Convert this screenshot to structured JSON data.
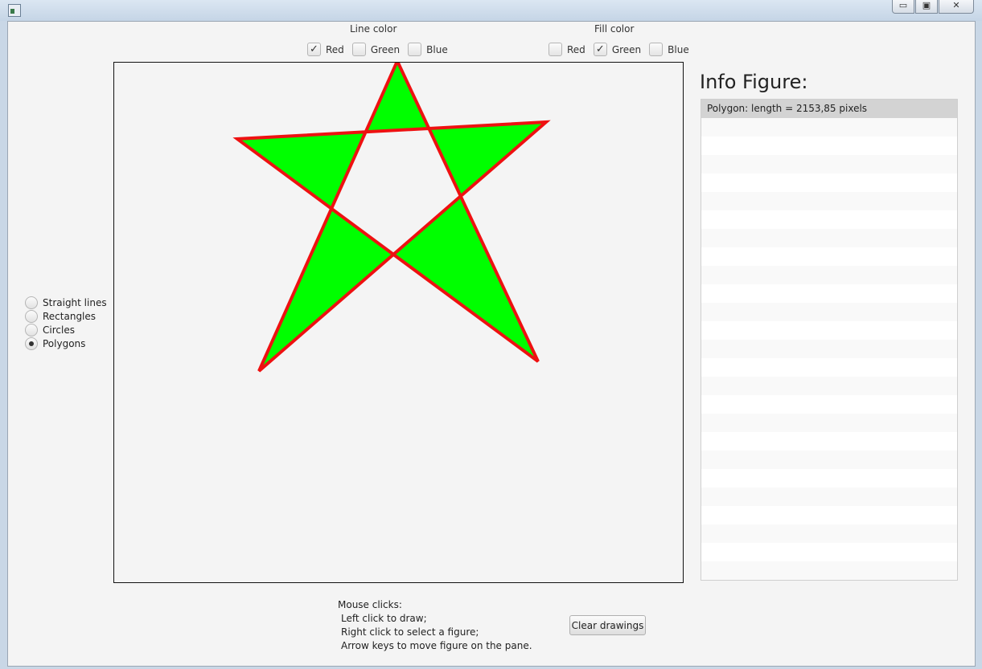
{
  "line_color": {
    "label": "Line color",
    "options": [
      {
        "label": "Red",
        "checked": true
      },
      {
        "label": "Green",
        "checked": false
      },
      {
        "label": "Blue",
        "checked": false
      }
    ]
  },
  "fill_color": {
    "label": "Fill color",
    "options": [
      {
        "label": "Red",
        "checked": false
      },
      {
        "label": "Green",
        "checked": true
      },
      {
        "label": "Blue",
        "checked": false
      }
    ]
  },
  "shape_modes": [
    {
      "label": "Straight lines",
      "selected": false
    },
    {
      "label": "Rectangles",
      "selected": false
    },
    {
      "label": "Circles",
      "selected": false
    },
    {
      "label": "Polygons",
      "selected": true
    }
  ],
  "figure": {
    "type": "polygon",
    "stroke": "#ee1111",
    "fill": "#00ff00"
  },
  "info": {
    "title": "Info Figure:",
    "items": [
      "Polygon: length = 2153,85 pixels"
    ]
  },
  "help": {
    "heading": "Mouse clicks:",
    "lines": [
      "Left click to draw;",
      "Right click to select a figure;",
      "Arrow keys to move figure on the pane."
    ]
  },
  "clear_label": "Clear drawings"
}
